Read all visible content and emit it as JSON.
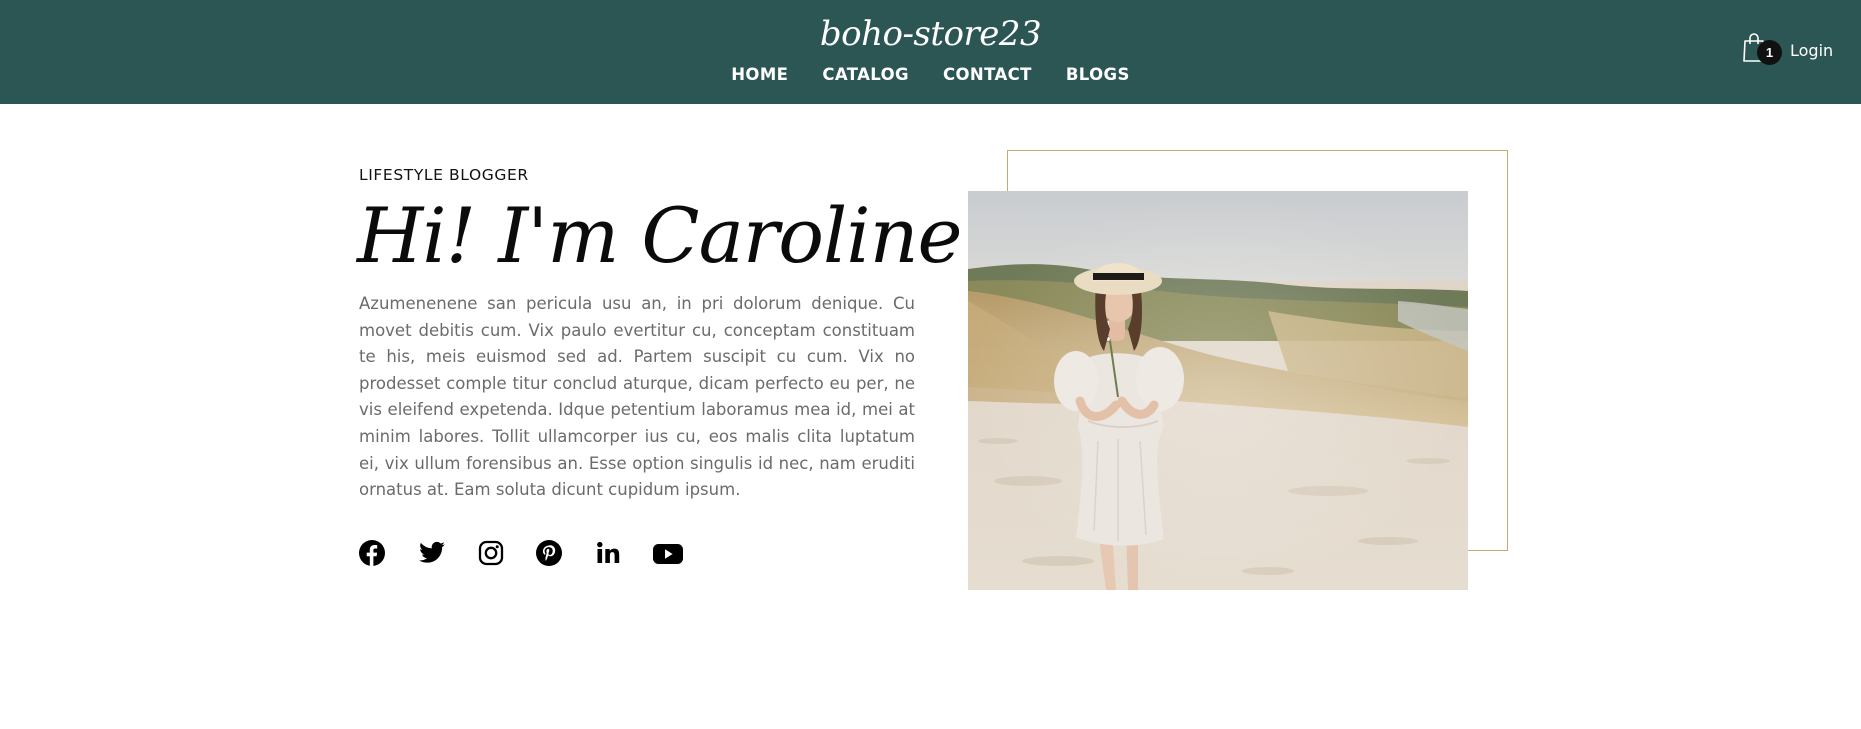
{
  "header": {
    "brand": "boho-store23",
    "nav": [
      "HOME",
      "CATALOG",
      "CONTACT",
      "BLOGS"
    ],
    "cart_count": "1",
    "login": "Login",
    "background": "#2c5654"
  },
  "hero": {
    "eyebrow": "LIFESTYLE BLOGGER",
    "title": "Hi! I'm Caroline",
    "text": "Azumenenene san pericula usu an, in pri dolorum denique. Cu movet debitis cum. Vix paulo evertitur cu, conceptam constituam te his, meis euismod sed ad. Partem suscipit cu cum. Vix no prodesset comple titur conclud aturque, dicam perfecto eu per, ne vis eleifend expetenda. Idque petentium laboramus mea id, mei at minim labores. Tollit ullamcorper ius cu, eos malis clita luptatum ei, vix ullum forensibus an. Esse option singulis id nec, nam eruditi ornatus at. Eam soluta dicunt cupidum ipsum.",
    "social": [
      "facebook-icon",
      "twitter-icon",
      "instagram-icon",
      "pinterest-icon",
      "linkedin-icon",
      "youtube-icon"
    ],
    "frame_color": "#c9a878"
  }
}
